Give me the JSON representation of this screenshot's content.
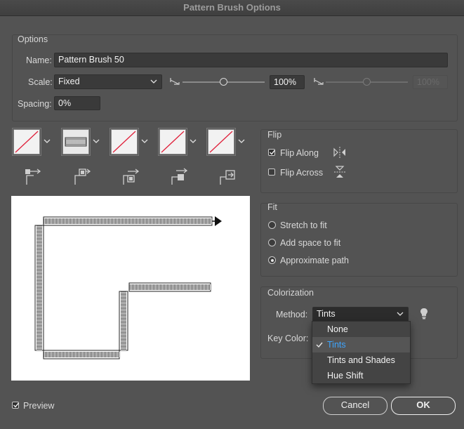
{
  "window": {
    "title": "Pattern Brush Options"
  },
  "options": {
    "group_label": "Options",
    "name_label": "Name:",
    "name_value": "Pattern Brush 50",
    "scale_label": "Scale:",
    "scale_value": "Fixed",
    "scale_percent": "100%",
    "scale_percent_disabled": "100%",
    "slider1_value": 100,
    "spacing_label": "Spacing:",
    "spacing_value": "0%"
  },
  "tiles": [
    {
      "name": "side-tile",
      "type": "none"
    },
    {
      "name": "outer-corner-tile",
      "type": "pattern"
    },
    {
      "name": "inner-corner-tile",
      "type": "none"
    },
    {
      "name": "start-tile",
      "type": "none"
    },
    {
      "name": "end-tile",
      "type": "none"
    }
  ],
  "flip": {
    "group_label": "Flip",
    "along_label": "Flip Along",
    "along_checked": true,
    "across_label": "Flip Across",
    "across_checked": false
  },
  "fit": {
    "group_label": "Fit",
    "options": [
      "Stretch to fit",
      "Add space to fit",
      "Approximate path"
    ],
    "selected": "Approximate path"
  },
  "colorization": {
    "group_label": "Colorization",
    "method_label": "Method:",
    "method_value": "Tints",
    "keycolor_label": "Key Color:",
    "menu": [
      "None",
      "Tints",
      "Tints and Shades",
      "Hue Shift"
    ],
    "menu_selected": "Tints"
  },
  "footer": {
    "preview_label": "Preview",
    "preview_checked": true,
    "cancel_label": "Cancel",
    "ok_label": "OK"
  },
  "colors": {
    "background": "#535353",
    "accent": "#3ea6ff",
    "tile_slash": "#e0203a"
  }
}
